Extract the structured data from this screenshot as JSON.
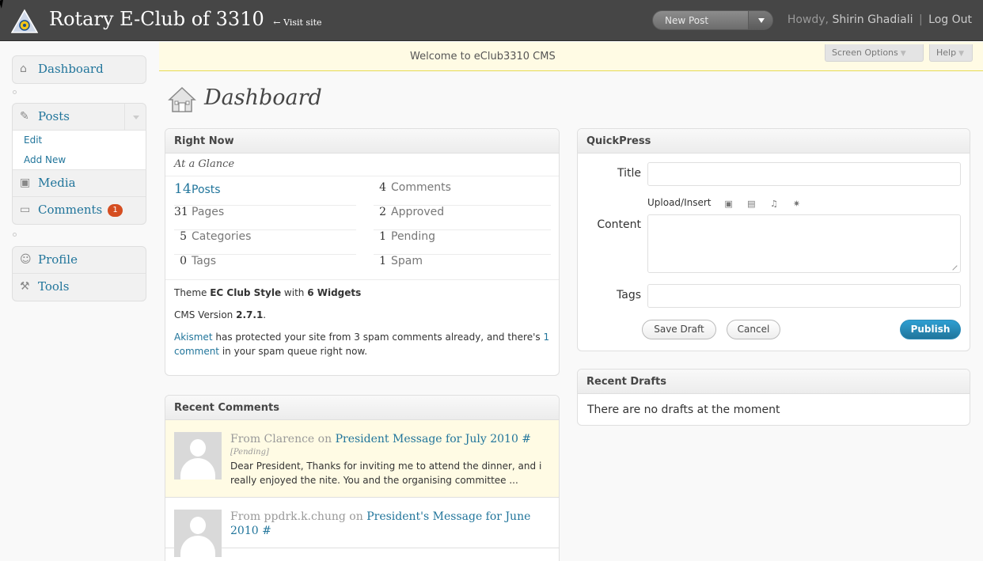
{
  "header": {
    "site_title": "Rotary E-Club of 3310",
    "visit_site": "← Visit site",
    "new_post": "New Post",
    "howdy": "Howdy,",
    "user_name": "Shirin Ghadiali",
    "separator": "|",
    "logout": "Log Out"
  },
  "welcome": {
    "text": "Welcome to eClub3310 CMS",
    "screen_options": "Screen Options",
    "help": "Help"
  },
  "sidebar": {
    "dashboard": "Dashboard",
    "posts": "Posts",
    "posts_sub": [
      "Edit",
      "Add New"
    ],
    "media": "Media",
    "comments": "Comments",
    "comments_badge": "1",
    "profile": "Profile",
    "tools": "Tools"
  },
  "page": {
    "title": "Dashboard"
  },
  "right_now": {
    "title": "Right Now",
    "subtitle": "At a Glance",
    "content": [
      {
        "num": "14",
        "label": "Posts"
      },
      {
        "num": "31",
        "label": "Pages"
      },
      {
        "num": "5",
        "label": "Categories"
      },
      {
        "num": "0",
        "label": "Tags"
      }
    ],
    "discussion": [
      {
        "num": "4",
        "label": "Comments"
      },
      {
        "num": "2",
        "label": "Approved"
      },
      {
        "num": "1",
        "label": "Pending"
      },
      {
        "num": "1",
        "label": "Spam"
      }
    ],
    "theme_prefix": "Theme",
    "theme_name": "EC Club Style",
    "theme_with": "with",
    "widgets": "6 Widgets",
    "version_prefix": "CMS Version",
    "version": "2.7.1",
    "version_suffix": ".",
    "akismet": "Akismet",
    "akismet_text": "has protected your site from 3 spam comments already, and there's",
    "akismet_link": "1 comment",
    "akismet_tail": "in your spam queue right now."
  },
  "recent_comments": {
    "title": "Recent Comments",
    "items": [
      {
        "from": "From Clarence on",
        "post": "President Message for July 2010 #",
        "status": "[Pending]",
        "text": "Dear President, Thanks for inviting me to attend the dinner, and i really enjoyed the nite. You and the organising committee ..."
      },
      {
        "from": "From ppdrk.k.chung on",
        "post": "President's Message for June 2010 #"
      }
    ]
  },
  "quickpress": {
    "title": "QuickPress",
    "title_label": "Title",
    "upload_insert": "Upload/Insert",
    "content_label": "Content",
    "tags_label": "Tags",
    "save_draft": "Save Draft",
    "cancel": "Cancel",
    "publish": "Publish"
  },
  "recent_drafts": {
    "title": "Recent Drafts",
    "empty": "There are no drafts at the moment"
  },
  "icons": {
    "logo": "rotary-logo-icon",
    "dashboard": "home-icon",
    "posts": "pushpin-icon",
    "media": "media-icon",
    "comments": "speech-bubble-icon",
    "profile": "users-icon",
    "tools": "tools-icon"
  },
  "colors": {
    "header_bg": "#464646",
    "link": "#21759b",
    "welcome_bg": "#fffbe4",
    "badge": "#d54e21",
    "publish": "#21759b"
  }
}
